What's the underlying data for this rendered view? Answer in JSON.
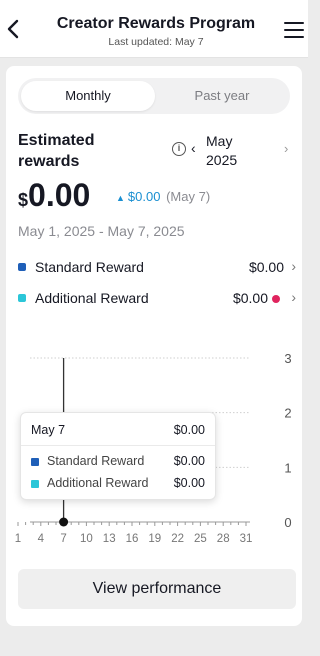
{
  "header": {
    "title": "Creator Rewards Program",
    "subtitle": "Last updated: May 7"
  },
  "tabs": [
    {
      "label": "Monthly",
      "active": true
    },
    {
      "label": "Past year",
      "active": false
    }
  ],
  "summary": {
    "label": "Estimated rewards",
    "period": "May 2025",
    "currency_symbol": "$",
    "amount": "0.00",
    "change": "$0.00",
    "change_date": "(May 7)",
    "date_range": "May 1, 2025 - May 7, 2025"
  },
  "breakdown": [
    {
      "label": "Standard Reward",
      "amount": "$0.00",
      "color": "#1f5fb8",
      "alert": false
    },
    {
      "label": "Additional Reward",
      "amount": "$0.00",
      "color": "#2bc6d8",
      "alert": true
    }
  ],
  "tooltip": {
    "date": "May 7",
    "total": "$0.00",
    "rows": [
      {
        "label": "Standard Reward",
        "amount": "$0.00",
        "color": "#1f5fb8"
      },
      {
        "label": "Additional Reward",
        "amount": "$0.00",
        "color": "#2bc6d8"
      }
    ]
  },
  "chart_data": {
    "type": "bar",
    "x_ticks": [
      "1",
      "4",
      "7",
      "10",
      "13",
      "16",
      "19",
      "22",
      "25",
      "28",
      "31"
    ],
    "y_ticks": [
      "0",
      "1",
      "2",
      "3"
    ],
    "ylim": [
      0,
      3
    ],
    "series": [
      {
        "name": "Standard Reward",
        "values": [
          0,
          0,
          0,
          0,
          0,
          0,
          0
        ],
        "x": [
          1,
          2,
          3,
          4,
          5,
          6,
          7
        ]
      },
      {
        "name": "Additional Reward",
        "values": [
          0,
          0,
          0,
          0,
          0,
          0,
          0
        ],
        "x": [
          1,
          2,
          3,
          4,
          5,
          6,
          7
        ]
      }
    ],
    "selected_x": 7,
    "colors": {
      "standard": "#1f5fb8",
      "additional": "#2bc6d8"
    }
  },
  "actions": {
    "view_performance": "View performance"
  }
}
